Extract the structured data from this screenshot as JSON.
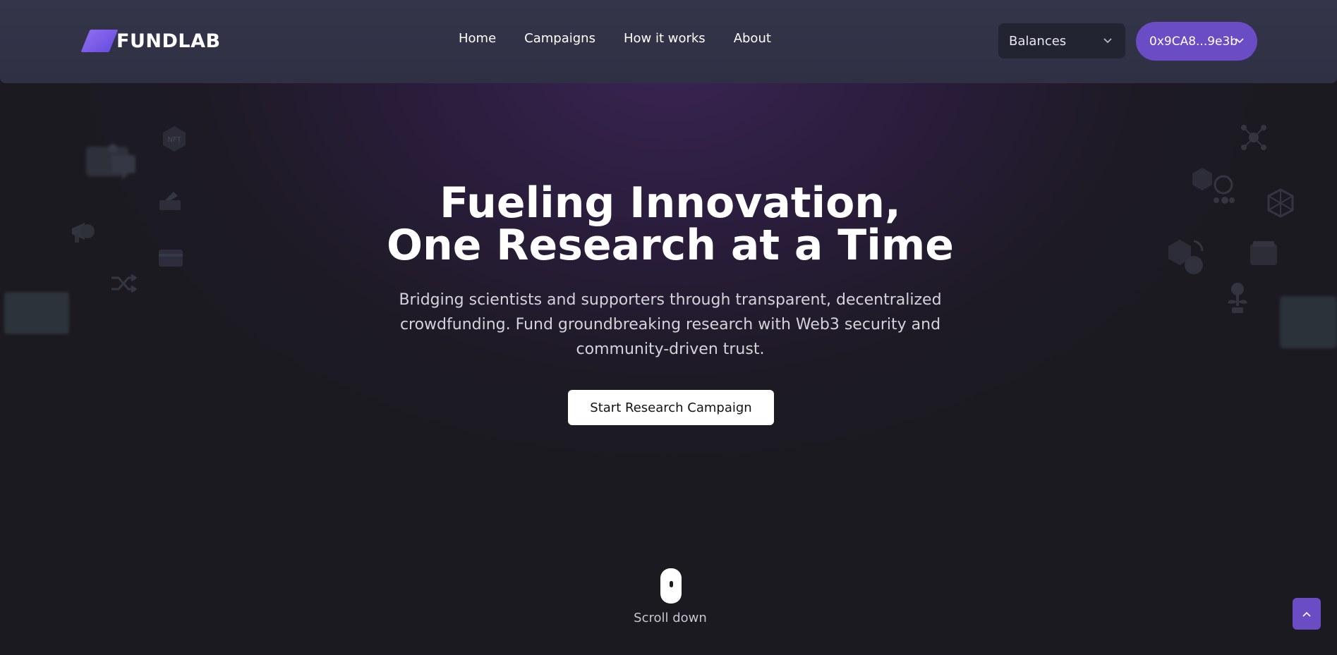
{
  "brand": {
    "name": "FUNDLAB",
    "accent": "#6a4cc4"
  },
  "nav": {
    "items": [
      {
        "label": "Home"
      },
      {
        "label": "Campaigns"
      },
      {
        "label": "How it works"
      },
      {
        "label": "About"
      }
    ]
  },
  "header": {
    "balances_label": "Balances",
    "wallet_address": "0x9CA8...9e3b"
  },
  "hero": {
    "title_line1": "Fueling Innovation,",
    "title_line2": "One Research at a Time",
    "subtitle": "Bridging scientists and supporters through transparent, decentralized crowdfunding. Fund groundbreaking research with Web3 security and community-driven trust.",
    "cta_label": "Start Research Campaign"
  },
  "scroll": {
    "label": "Scroll down"
  },
  "decorations": {
    "icons": [
      "chat-window-icon",
      "nft-badge-icon",
      "wallet-card-icon",
      "credit-card-icon",
      "megaphone-icon",
      "shuffle-icon",
      "network-node-icon",
      "cubes-network-icon",
      "blockchain-icon",
      "wallet-icon",
      "cubes-exchange-icon",
      "plant-coin-icon"
    ]
  }
}
